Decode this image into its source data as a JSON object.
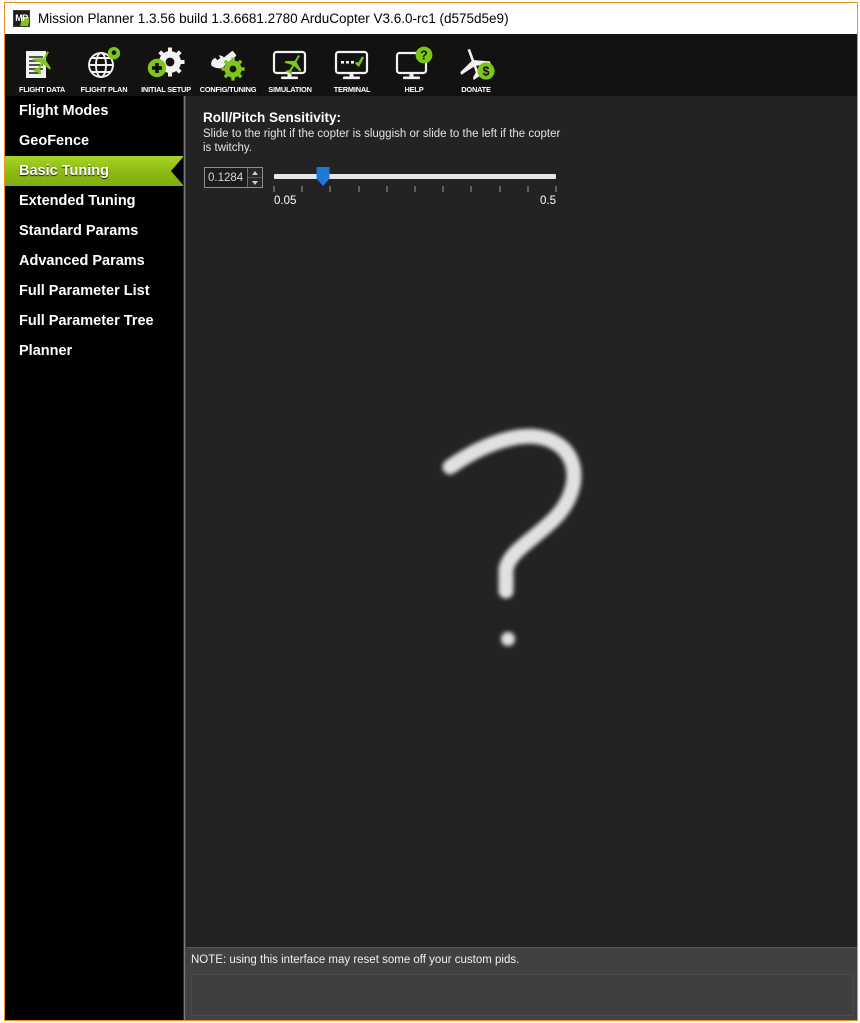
{
  "window": {
    "title": "Mission Planner 1.3.56 build 1.3.6681.2780 ArduCopter V3.6.0-rc1 (d575d5e9)",
    "app_icon": "mission-planner-icon",
    "accent_border_color": "#e8921f"
  },
  "toolbar": {
    "items": [
      {
        "label": "FLIGHT DATA",
        "icon": "flight-data-icon"
      },
      {
        "label": "FLIGHT PLAN",
        "icon": "flight-plan-icon"
      },
      {
        "label": "INITIAL SETUP",
        "icon": "initial-setup-icon"
      },
      {
        "label": "CONFIG/TUNING",
        "icon": "config-tuning-icon"
      },
      {
        "label": "SIMULATION",
        "icon": "simulation-icon"
      },
      {
        "label": "TERMINAL",
        "icon": "terminal-icon"
      },
      {
        "label": "HELP",
        "icon": "help-icon"
      },
      {
        "label": "DONATE",
        "icon": "donate-icon"
      }
    ],
    "accent_green": "#7ec61a"
  },
  "sidebar": {
    "active_color": "#8cbb16",
    "items": [
      {
        "label": "Flight Modes",
        "active": false
      },
      {
        "label": "GeoFence",
        "active": false
      },
      {
        "label": "Basic Tuning",
        "active": true
      },
      {
        "label": "Extended Tuning",
        "active": false
      },
      {
        "label": "Standard Params",
        "active": false
      },
      {
        "label": "Advanced Params",
        "active": false
      },
      {
        "label": "Full Parameter List",
        "active": false
      },
      {
        "label": "Full Parameter Tree",
        "active": false
      },
      {
        "label": "Planner",
        "active": false
      }
    ]
  },
  "main": {
    "section_title": "Roll/Pitch Sensitivity:",
    "section_description": "Slide to the right if the copter is sluggish or slide to the left if the copter is twitchy.",
    "value_field": {
      "value": "0.1284",
      "spinner_up": "increment",
      "spinner_down": "decrement"
    },
    "slider": {
      "value": 0.1284,
      "min": 0.05,
      "max": 0.5,
      "min_label": "0.05",
      "max_label": "0.5",
      "tick_count": 11,
      "thumb_percent": 17.4,
      "thumb_color": "#1f78d6",
      "track_color": "#e6e6e6"
    },
    "watermark": "question-mark-watermark"
  },
  "note": {
    "text": "NOTE: using this interface may reset some off your custom pids."
  }
}
